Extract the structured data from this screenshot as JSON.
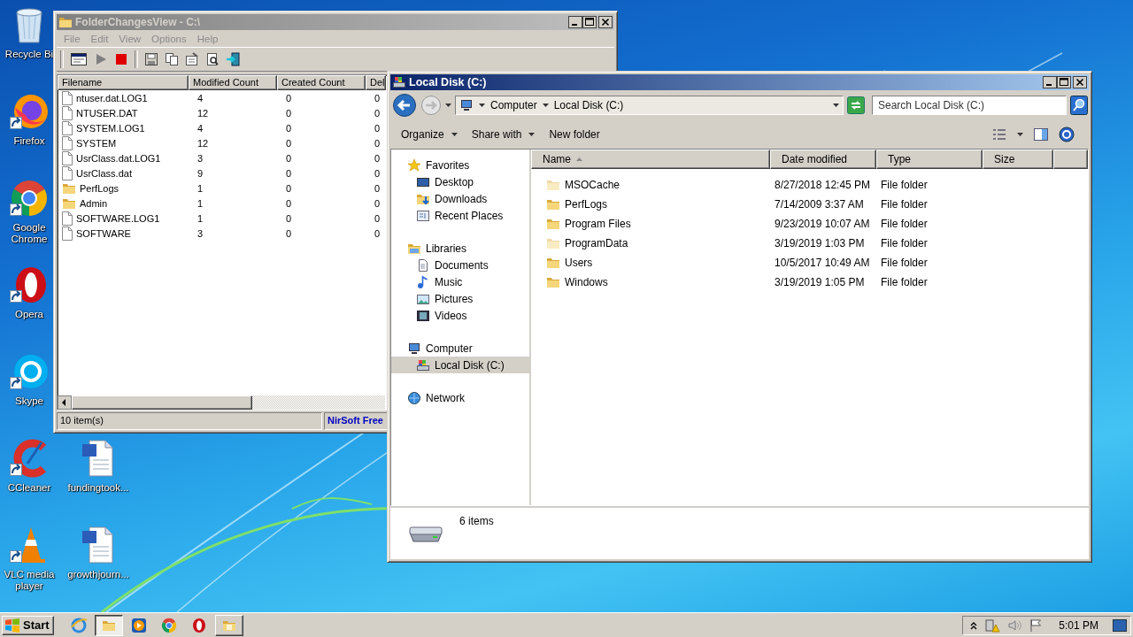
{
  "desktop": {
    "icon_rows": [
      [
        {
          "label": "Recycle Bi",
          "kind": "recycle_bin",
          "shortcut": false
        }
      ],
      [
        {
          "label": "Firefox",
          "kind": "firefox",
          "shortcut": true
        }
      ],
      [
        {
          "label": "Google Chrome",
          "kind": "chrome",
          "shortcut": true
        }
      ],
      [
        {
          "label": "Opera",
          "kind": "opera",
          "shortcut": true
        }
      ],
      [
        {
          "label": "Skype",
          "kind": "skype",
          "shortcut": true
        }
      ],
      [
        {
          "label": "CCleaner",
          "kind": "ccleaner",
          "shortcut": true
        },
        {
          "label": "fundingtook...",
          "kind": "word_document",
          "shortcut": false
        }
      ],
      [
        {
          "label": "VLC media player",
          "kind": "vlc",
          "shortcut": true
        },
        {
          "label": "growthjourn...",
          "kind": "word_document",
          "shortcut": false
        }
      ]
    ]
  },
  "folderchangesview": {
    "title": "FolderChangesView - C:\\",
    "active": false,
    "menu": [
      "File",
      "Edit",
      "View",
      "Options",
      "Help"
    ],
    "columns": [
      "Filename",
      "Modified Count",
      "Created Count",
      "Del"
    ],
    "rows": [
      {
        "kind": "file",
        "cells": [
          "ntuser.dat.LOG1",
          "4",
          "0",
          "0"
        ]
      },
      {
        "kind": "file",
        "cells": [
          "NTUSER.DAT",
          "12",
          "0",
          "0"
        ]
      },
      {
        "kind": "file",
        "cells": [
          "SYSTEM.LOG1",
          "4",
          "0",
          "0"
        ]
      },
      {
        "kind": "file",
        "cells": [
          "SYSTEM",
          "12",
          "0",
          "0"
        ]
      },
      {
        "kind": "file",
        "cells": [
          "UsrClass.dat.LOG1",
          "3",
          "0",
          "0"
        ]
      },
      {
        "kind": "file",
        "cells": [
          "UsrClass.dat",
          "9",
          "0",
          "0"
        ]
      },
      {
        "kind": "folder",
        "cells": [
          "PerfLogs",
          "1",
          "0",
          "0"
        ]
      },
      {
        "kind": "folder",
        "cells": [
          "Admin",
          "1",
          "0",
          "0"
        ]
      },
      {
        "kind": "file",
        "cells": [
          "SOFTWARE.LOG1",
          "1",
          "0",
          "0"
        ]
      },
      {
        "kind": "file",
        "cells": [
          "SOFTWARE",
          "3",
          "0",
          "0"
        ]
      }
    ],
    "status_bar": [
      "10 item(s)",
      "NirSoft Free"
    ]
  },
  "explorer": {
    "title": "Local Disk (C:)",
    "active": true,
    "breadcrumb": [
      "Computer",
      "Local Disk (C:)"
    ],
    "search": {
      "placeholder": "Search Local Disk (C:)"
    },
    "toolbar": [
      {
        "label": "Organize",
        "dropdown": true
      },
      {
        "label": "Share with",
        "dropdown": true
      },
      {
        "label": "New folder",
        "dropdown": false
      }
    ],
    "navigation": [
      {
        "label": "Favorites",
        "kind": "favorites",
        "selected": false,
        "children": [
          {
            "label": "Desktop",
            "kind": "desktop",
            "selected": false
          },
          {
            "label": "Downloads",
            "kind": "downloads",
            "selected": false
          },
          {
            "label": "Recent Places",
            "kind": "recent",
            "selected": false
          }
        ]
      },
      {
        "label": "Libraries",
        "kind": "libraries",
        "selected": false,
        "children": [
          {
            "label": "Documents",
            "kind": "documents",
            "selected": false
          },
          {
            "label": "Music",
            "kind": "music",
            "selected": false
          },
          {
            "label": "Pictures",
            "kind": "pictures",
            "selected": false
          },
          {
            "label": "Videos",
            "kind": "videos",
            "selected": false
          }
        ]
      },
      {
        "label": "Computer",
        "kind": "computer",
        "selected": false,
        "children": [
          {
            "label": "Local Disk (C:)",
            "kind": "drive",
            "selected": true
          }
        ]
      },
      {
        "label": "Network",
        "kind": "network",
        "selected": false
      }
    ],
    "columns": [
      {
        "label": "Name",
        "sorted": true
      },
      {
        "label": "Date modified",
        "sorted": false
      },
      {
        "label": "Type",
        "sorted": false
      },
      {
        "label": "Size",
        "sorted": false
      }
    ],
    "rows": [
      {
        "name": "MSOCache",
        "date_modified": "8/27/2018 12:45 PM",
        "type": "File folder",
        "hidden": true
      },
      {
        "name": "PerfLogs",
        "date_modified": "7/14/2009 3:37 AM",
        "type": "File folder",
        "hidden": false
      },
      {
        "name": "Program Files",
        "date_modified": "9/23/2019 10:07 AM",
        "type": "File folder",
        "hidden": false
      },
      {
        "name": "ProgramData",
        "date_modified": "3/19/2019 1:03 PM",
        "type": "File folder",
        "hidden": true
      },
      {
        "name": "Users",
        "date_modified": "10/5/2017 10:49 AM",
        "type": "File folder",
        "hidden": false
      },
      {
        "name": "Windows",
        "date_modified": "3/19/2019 1:05 PM",
        "type": "File folder",
        "hidden": false
      }
    ],
    "details": "6 items"
  },
  "taskbar": {
    "start": "Start",
    "items": [
      {
        "kind": "internet_explorer",
        "open": false,
        "selected": false
      },
      {
        "kind": "file_explorer",
        "open": true,
        "selected": true
      },
      {
        "kind": "media_player",
        "open": false,
        "selected": false
      },
      {
        "kind": "chrome",
        "open": false,
        "selected": false
      },
      {
        "kind": "opera",
        "open": false,
        "selected": false
      },
      {
        "kind": "folder_window",
        "open": true,
        "selected": false
      }
    ],
    "clock": "5:01 PM"
  }
}
